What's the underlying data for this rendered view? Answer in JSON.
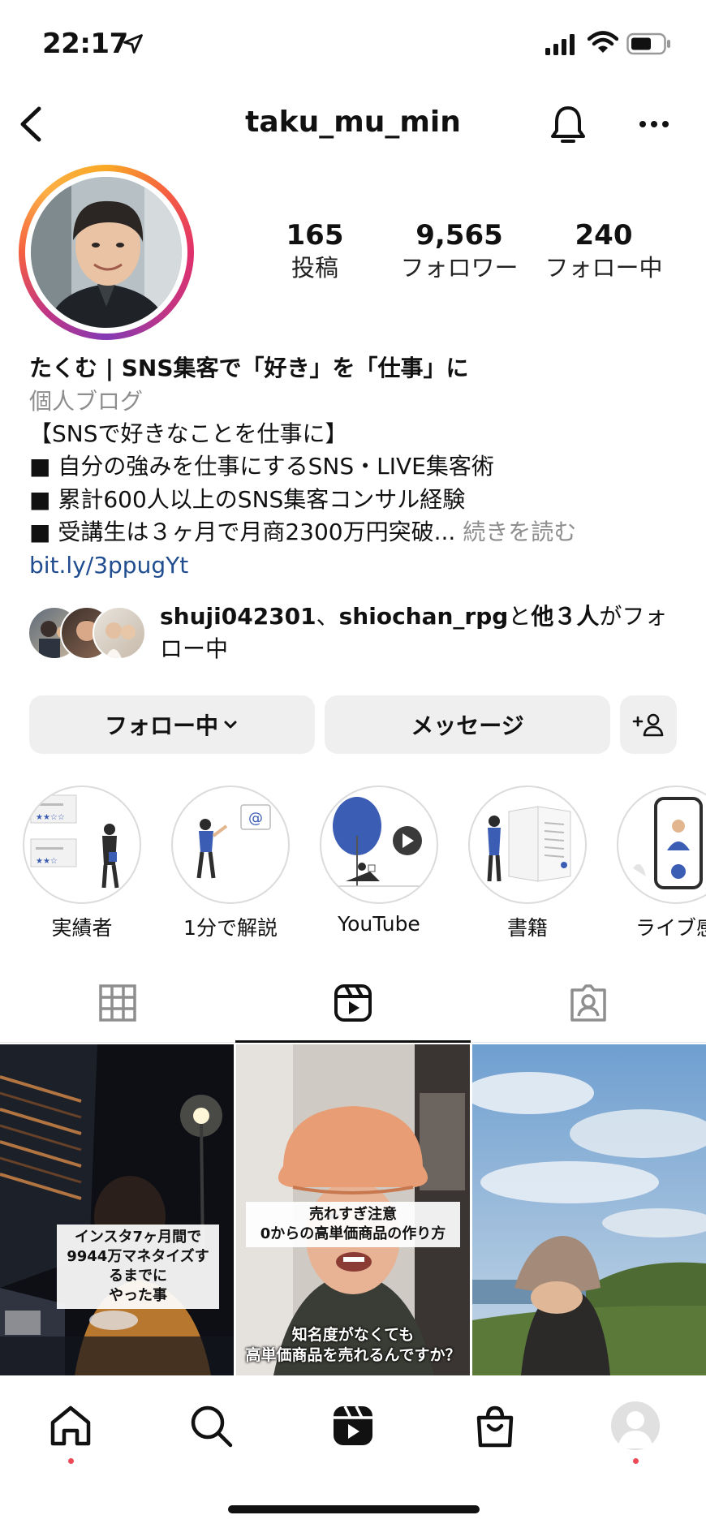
{
  "status_bar": {
    "time": "22:17"
  },
  "header": {
    "username": "taku_mu_min"
  },
  "stats": [
    {
      "value": "165",
      "label": "投稿"
    },
    {
      "value": "9,565",
      "label": "フォロワー"
    },
    {
      "value": "240",
      "label": "フォロー中"
    }
  ],
  "bio": {
    "name": "たくむ | SNS集客で「好き」を「仕事」に",
    "category": "個人ブログ",
    "lines": [
      "【SNSで好きなことを仕事に】",
      "■ 自分の強みを仕事にするSNS・LIVE集客術",
      "■ 累計600人以上のSNS集客コンサル経験",
      "■ 受講生は３ヶ月で月商2300万円突破..."
    ],
    "more": "続きを読む",
    "url": "bit.ly/3ppugYt"
  },
  "followed_by": {
    "user1": "shuji042301",
    "sep": "、",
    "user2": "shiochan_rpg",
    "mid": "と",
    "others": "他３人",
    "tail": "がフォロー中"
  },
  "buttons": {
    "follow": "フォロー中",
    "message": "メッセージ"
  },
  "highlights": [
    {
      "label": "実績者"
    },
    {
      "label": "1分で解説"
    },
    {
      "label": "YouTube"
    },
    {
      "label": "書籍"
    },
    {
      "label": "ライブ感"
    }
  ],
  "grid": [
    {
      "caption": "インスタ7ヶ月間で\n9944万マネタイズするまでに\nやった事"
    },
    {
      "caption": "売れすぎ注意\n0からの高単価商品の作り方",
      "subtitle": "知名度がなくても\n高単価商品を売れるんですか？"
    },
    {
      "caption": ""
    }
  ],
  "colors": {
    "link": "#1f4d8f",
    "muted": "#8e8e8e",
    "button_bg": "#efefef",
    "notification": "#ed4956"
  }
}
